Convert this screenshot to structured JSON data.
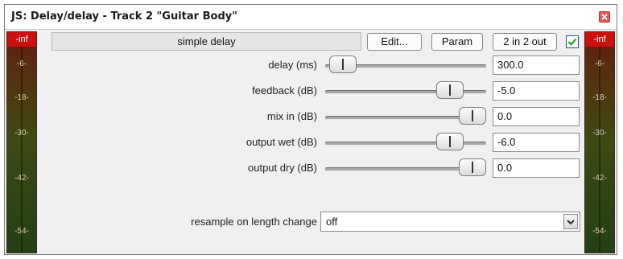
{
  "window": {
    "title": "JS: Delay/delay - Track 2 \"Guitar Body\"",
    "close_icon": "close-icon"
  },
  "meters": {
    "peak_label": "-inf",
    "ticks": [
      "-6-",
      "-18-",
      "-30-",
      "-42-",
      "-54-"
    ]
  },
  "toolbar": {
    "plugin_name": "simple delay",
    "edit_label": "Edit...",
    "param_label": "Param",
    "io_label": "2 in 2 out",
    "enabled_checked": true
  },
  "params": [
    {
      "label": "delay (ms)",
      "value": "300.0",
      "slider_fraction": 0.03
    },
    {
      "label": "feedback (dB)",
      "value": "-5.0",
      "slider_fraction": 0.83
    },
    {
      "label": "mix in (dB)",
      "value": "0.0",
      "slider_fraction": 1.0
    },
    {
      "label": "output wet (dB)",
      "value": "-6.0",
      "slider_fraction": 0.83
    },
    {
      "label": "output dry (dB)",
      "value": "0.0",
      "slider_fraction": 1.0
    }
  ],
  "resample": {
    "label": "resample on length change",
    "value": "off"
  },
  "colors": {
    "meter_top": "#cc1010",
    "checkbox_check": "#1fa31f"
  }
}
